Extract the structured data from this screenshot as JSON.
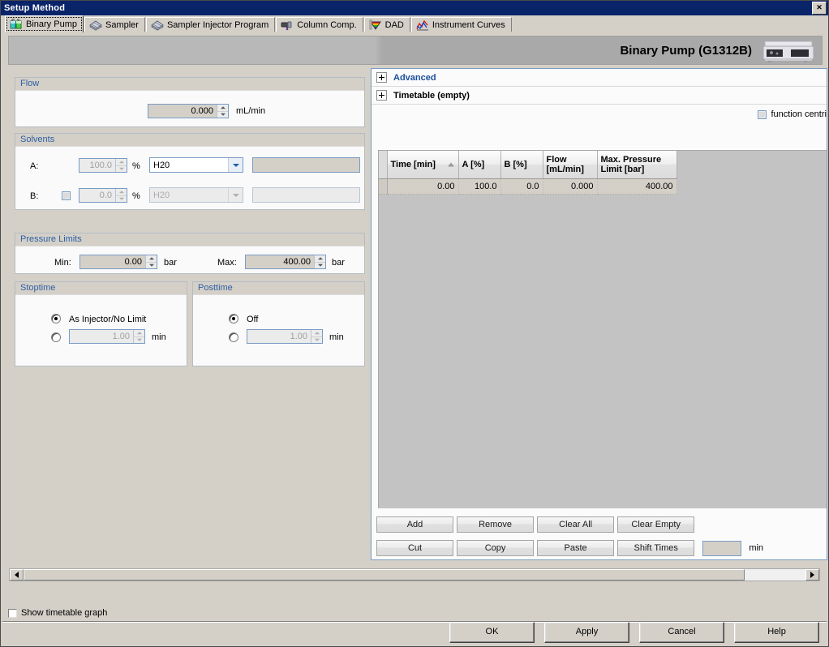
{
  "window": {
    "title": "Setup Method",
    "close_label": "✕"
  },
  "tabs": [
    {
      "label": "Binary Pump",
      "icon": "binary-pump-icon",
      "active": true
    },
    {
      "label": "Sampler",
      "icon": "sampler-icon",
      "active": false
    },
    {
      "label": "Sampler Injector Program",
      "icon": "sampler-injector-icon",
      "active": false
    },
    {
      "label": "Column Comp.",
      "icon": "column-comp-icon",
      "active": false
    },
    {
      "label": "DAD",
      "icon": "dad-prism-icon",
      "active": false
    },
    {
      "label": "Instrument Curves",
      "icon": "instrument-curves-icon",
      "active": false
    }
  ],
  "header": {
    "device_title": "Binary Pump (G1312B)"
  },
  "flow": {
    "group_title": "Flow",
    "value": "0.000",
    "unit": "mL/min"
  },
  "solvents": {
    "group_title": "Solvents",
    "rows": [
      {
        "label": "A:",
        "percent": "100.0",
        "percent_symbol": "%",
        "solvent": "H20",
        "name": "",
        "has_checkbox": false,
        "enabled": false
      },
      {
        "label": "B:",
        "percent": "0.0",
        "percent_symbol": "%",
        "solvent": "H20",
        "name": "",
        "has_checkbox": true,
        "enabled": false
      }
    ]
  },
  "pressure_limits": {
    "group_title": "Pressure Limits",
    "min_label": "Min:",
    "min_value": "0.00",
    "min_unit": "bar",
    "max_label": "Max:",
    "max_value": "400.00",
    "max_unit": "bar"
  },
  "stoptime": {
    "group_title": "Stoptime",
    "option1_label": "As Injector/No Limit",
    "option1_selected": true,
    "option2_selected": false,
    "option2_value": "1.00",
    "option2_unit": "min"
  },
  "posttime": {
    "group_title": "Posttime",
    "option1_label": "Off",
    "option1_selected": true,
    "option2_selected": false,
    "option2_value": "1.00",
    "option2_unit": "min"
  },
  "right": {
    "advanced_label": "Advanced",
    "timetable_label": "Timetable (empty)",
    "function_centric_label": "function centric v",
    "table": {
      "columns": [
        "Time [min]",
        "A [%]",
        "B [%]",
        "Flow\n[mL/min]",
        "Max. Pressure\nLimit [bar]"
      ],
      "columns_display": [
        {
          "line1": "Time [min]",
          "line2": "",
          "sorted": true
        },
        {
          "line1": "A [%]",
          "line2": "",
          "sorted": false
        },
        {
          "line1": "B [%]",
          "line2": "",
          "sorted": false
        },
        {
          "line1": "Flow",
          "line2": "[mL/min]",
          "sorted": false
        },
        {
          "line1": "Max. Pressure",
          "line2": "Limit [bar]",
          "sorted": false
        }
      ],
      "rows": [
        [
          "0.00",
          "100.0",
          "0.0",
          "0.000",
          "400.00"
        ]
      ]
    },
    "buttons_row1": [
      "Add",
      "Remove",
      "Clear All",
      "Clear Empty"
    ],
    "buttons_row2": [
      "Cut",
      "Copy",
      "Paste",
      "Shift Times"
    ],
    "shift_value": "",
    "shift_unit": "min"
  },
  "footer": {
    "show_timetable_graph": "Show timetable graph",
    "ok": "OK",
    "apply": "Apply",
    "cancel": "Cancel",
    "help": "Help"
  },
  "colors": {
    "titlebar": "#0a246a",
    "group_title": "#2e5fa3",
    "section_title": "#1b4f9c",
    "face": "#d4d0c8",
    "panel": "#fbfbfb"
  }
}
